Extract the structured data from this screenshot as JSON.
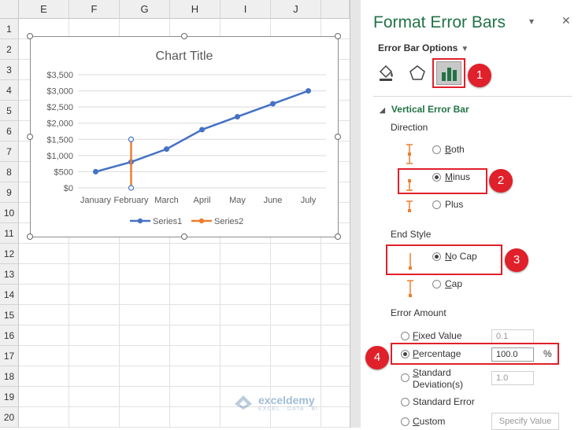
{
  "sheet": {
    "columns": [
      "E",
      "F",
      "G",
      "H",
      "I",
      "J"
    ],
    "rows": [
      "1",
      "2",
      "3",
      "4",
      "5",
      "6",
      "7",
      "8",
      "9",
      "10",
      "11",
      "12",
      "13",
      "14",
      "15",
      "16",
      "17",
      "18",
      "19",
      "20"
    ]
  },
  "chart_data": {
    "type": "line",
    "title": "Chart Title",
    "categories": [
      "January",
      "February",
      "March",
      "April",
      "May",
      "June",
      "July"
    ],
    "y_ticks": [
      "$3,500",
      "$3,000",
      "$2,500",
      "$2,000",
      "$1,500",
      "$1,000",
      "$500",
      "$0"
    ],
    "ylim": [
      0,
      3500
    ],
    "grid": true,
    "legend_position": "bottom",
    "series": [
      {
        "name": "Series1",
        "color": "#4472c4",
        "values": [
          500,
          800,
          1200,
          1800,
          2200,
          2600,
          3000
        ]
      },
      {
        "name": "Series2",
        "color": "#ed7d31",
        "error_bar": {
          "category": "February",
          "low": 0,
          "high": 1500
        }
      }
    ]
  },
  "panel": {
    "title": "Format Error Bars",
    "options_label": "Error Bar Options",
    "section": "Vertical Error Bar",
    "direction_label": "Direction",
    "direction": [
      "Both",
      "Minus",
      "Plus"
    ],
    "end_style_label": "End Style",
    "end_style": [
      "No Cap",
      "Cap"
    ],
    "amount_label": "Error Amount",
    "amount_options": {
      "fixed": "Fixed Value",
      "percentage": "Percentage",
      "std_dev_1": "Standard",
      "std_dev_2": "Deviation(s)",
      "std_error": "Standard Error",
      "custom": "Custom"
    },
    "fixed_value": "0.1",
    "percentage_value": "100.0",
    "percent_sign": "%",
    "std_dev_value": "1.0",
    "specify_button": "Specify Value",
    "selected": {
      "direction": "Minus",
      "end_style": "No Cap",
      "amount": "Percentage"
    }
  },
  "badges": [
    "1",
    "2",
    "3",
    "4"
  ],
  "watermark": {
    "name": "exceldemy",
    "tagline": "EXCEL · DATA · BI"
  },
  "colors": {
    "accent": "#217346",
    "highlight": "#e0202a",
    "series1": "#4472c4",
    "series2": "#ed7d31"
  }
}
